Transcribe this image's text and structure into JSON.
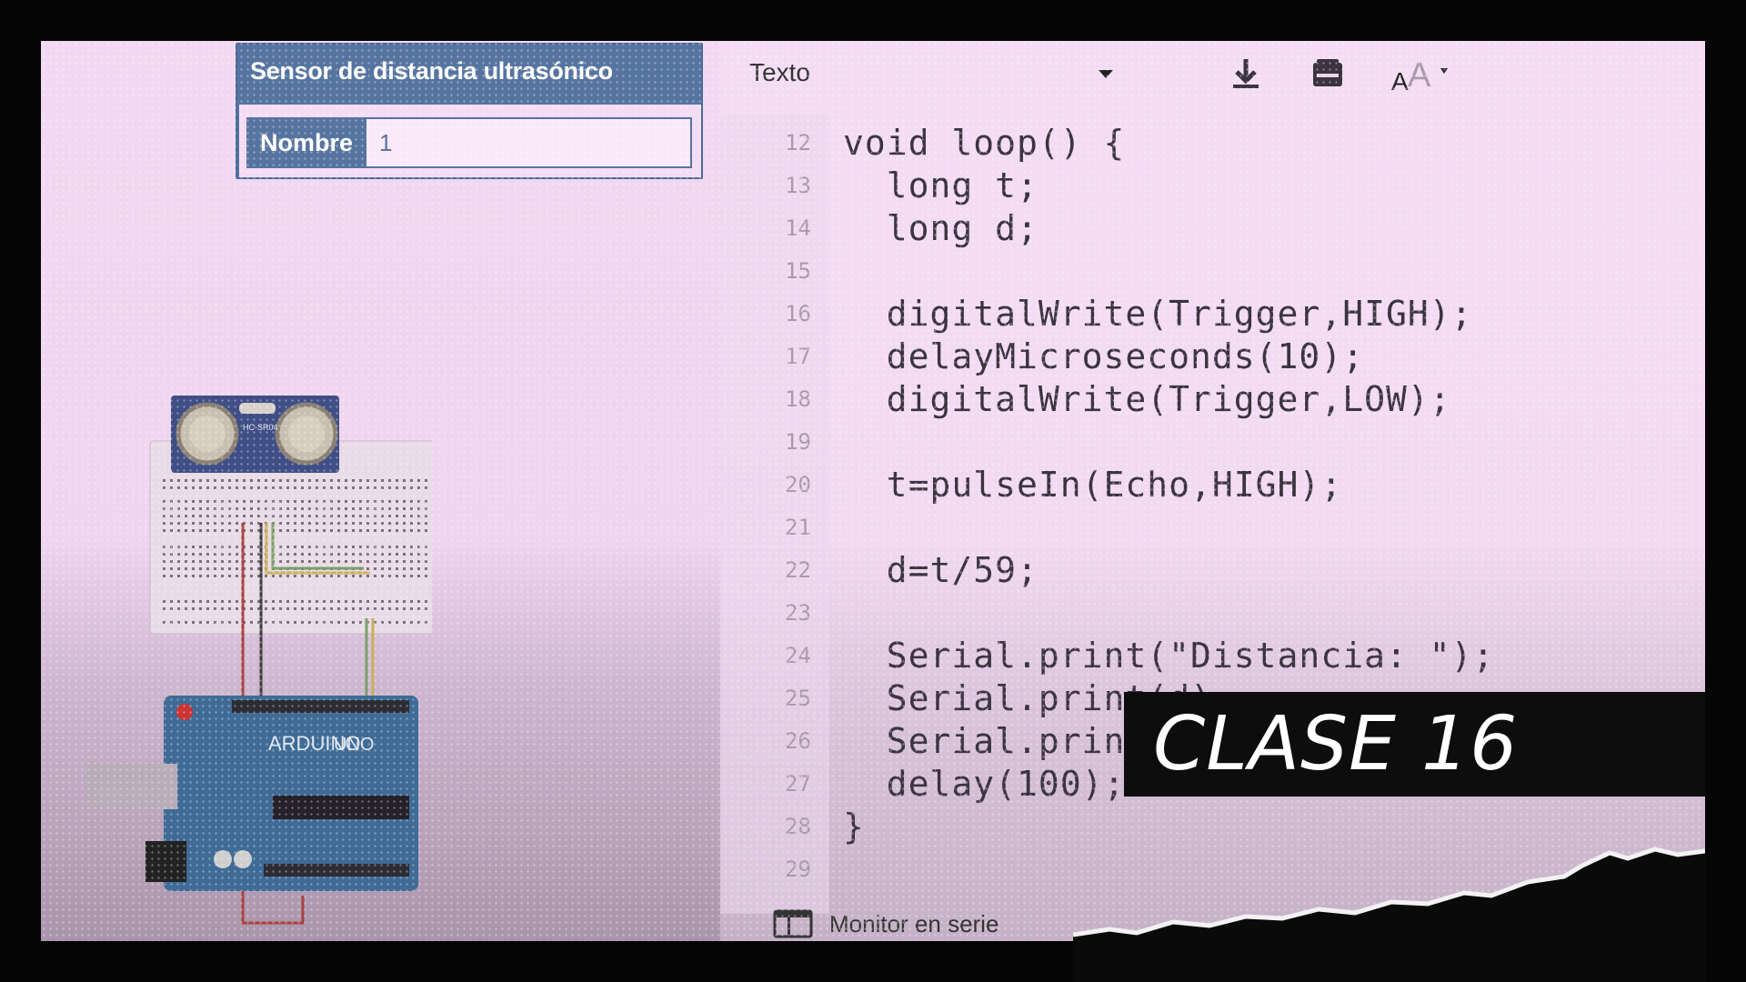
{
  "properties_panel": {
    "title": "Sensor de distancia ultrasónico",
    "name_label": "Nombre",
    "name_value": "1"
  },
  "toolbar": {
    "mode_value": "Texto",
    "icons": [
      "download-icon",
      "library-icon",
      "font-size-icon"
    ]
  },
  "code": {
    "lines": [
      {
        "n": "12",
        "text": "void loop() {"
      },
      {
        "n": "13",
        "text": "  long t;"
      },
      {
        "n": "14",
        "text": "  long d;"
      },
      {
        "n": "15",
        "text": ""
      },
      {
        "n": "16",
        "text": "  digitalWrite(Trigger,HIGH);"
      },
      {
        "n": "17",
        "text": "  delayMicroseconds(10);"
      },
      {
        "n": "18",
        "text": "  digitalWrite(Trigger,LOW);"
      },
      {
        "n": "19",
        "text": ""
      },
      {
        "n": "20",
        "text": "  t=pulseIn(Echo,HIGH);"
      },
      {
        "n": "21",
        "text": ""
      },
      {
        "n": "22",
        "text": "  d=t/59;"
      },
      {
        "n": "23",
        "text": ""
      },
      {
        "n": "24",
        "text": "  Serial.print(\"Distancia: \");"
      },
      {
        "n": "25",
        "text": "  Serial.print(d);"
      },
      {
        "n": "26",
        "text": "  Serial.print"
      },
      {
        "n": "27",
        "text": "  delay(100);"
      },
      {
        "n": "28",
        "text": "}"
      },
      {
        "n": "29",
        "text": ""
      }
    ]
  },
  "serial_monitor": {
    "label": "Monitor en serie"
  },
  "banner": {
    "text": "CLASE 16"
  },
  "circuit": {
    "sensor_label": "HC-SR04",
    "board_label": "UNO",
    "board_brand": "ARDUINO"
  },
  "colors": {
    "panel_blue": "#5674a0",
    "background": "#f2d9f2",
    "banner": "#0d0d0d"
  }
}
